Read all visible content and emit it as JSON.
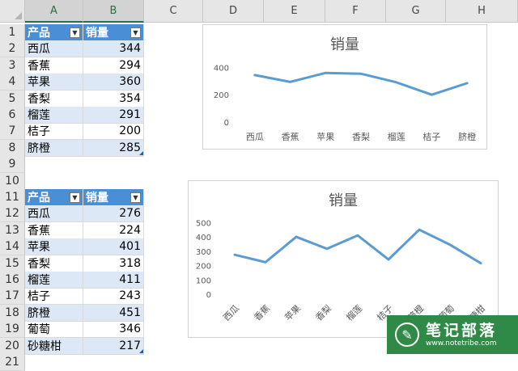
{
  "columns": [
    "A",
    "B",
    "C",
    "D",
    "E",
    "F",
    "G",
    "H"
  ],
  "rows": [
    "1",
    "2",
    "3",
    "4",
    "5",
    "6",
    "7",
    "8",
    "9",
    "10",
    "11",
    "12",
    "13",
    "14",
    "15",
    "16",
    "17",
    "18",
    "19",
    "20",
    "21"
  ],
  "table1": {
    "headers": [
      "产品",
      "销量"
    ],
    "dropdown_icon": "dropdown-arrow-icon",
    "rows": [
      {
        "product": "西瓜",
        "sales": "344"
      },
      {
        "product": "香蕉",
        "sales": "294"
      },
      {
        "product": "苹果",
        "sales": "360"
      },
      {
        "product": "香梨",
        "sales": "354"
      },
      {
        "product": "榴莲",
        "sales": "291"
      },
      {
        "product": "桔子",
        "sales": "200"
      },
      {
        "product": "脐橙",
        "sales": "285"
      }
    ]
  },
  "table2": {
    "headers": [
      "产品",
      "销量"
    ],
    "dropdown_icon": "dropdown-arrow-icon",
    "rows": [
      {
        "product": "西瓜",
        "sales": "276"
      },
      {
        "product": "香蕉",
        "sales": "224"
      },
      {
        "product": "苹果",
        "sales": "401"
      },
      {
        "product": "香梨",
        "sales": "318"
      },
      {
        "product": "榴莲",
        "sales": "411"
      },
      {
        "product": "桔子",
        "sales": "243"
      },
      {
        "product": "脐橙",
        "sales": "451"
      },
      {
        "product": "葡萄",
        "sales": "346"
      },
      {
        "product": "砂糖柑",
        "sales": "217"
      }
    ]
  },
  "colors": {
    "line": "#5b9bd5",
    "header": "#4a8fd6",
    "band": "#dde8f6",
    "watermark": "#2f8a47"
  },
  "chart_data": [
    {
      "type": "line",
      "title": "销量",
      "categories": [
        "西瓜",
        "香蕉",
        "苹果",
        "香梨",
        "榴莲",
        "桔子",
        "脐橙"
      ],
      "values": [
        344,
        294,
        360,
        354,
        291,
        200,
        285
      ],
      "yticks": [
        0,
        200,
        400
      ],
      "ylim": [
        0,
        450
      ],
      "grid": false,
      "legend": "none"
    },
    {
      "type": "line",
      "title": "销量",
      "categories": [
        "西瓜",
        "香蕉",
        "苹果",
        "香梨",
        "榴莲",
        "桔子",
        "脐橙",
        "葡萄",
        "砂糖柑"
      ],
      "values": [
        276,
        224,
        401,
        318,
        411,
        243,
        451,
        346,
        217
      ],
      "yticks": [
        0,
        100,
        200,
        300,
        400,
        500
      ],
      "ylim": [
        0,
        520
      ],
      "grid": false,
      "legend": "none",
      "tick_label_rotation": "diagonal"
    }
  ],
  "watermark": {
    "icon": "pen-icon",
    "title": "笔记部落",
    "url": "www.notetribe.com"
  }
}
